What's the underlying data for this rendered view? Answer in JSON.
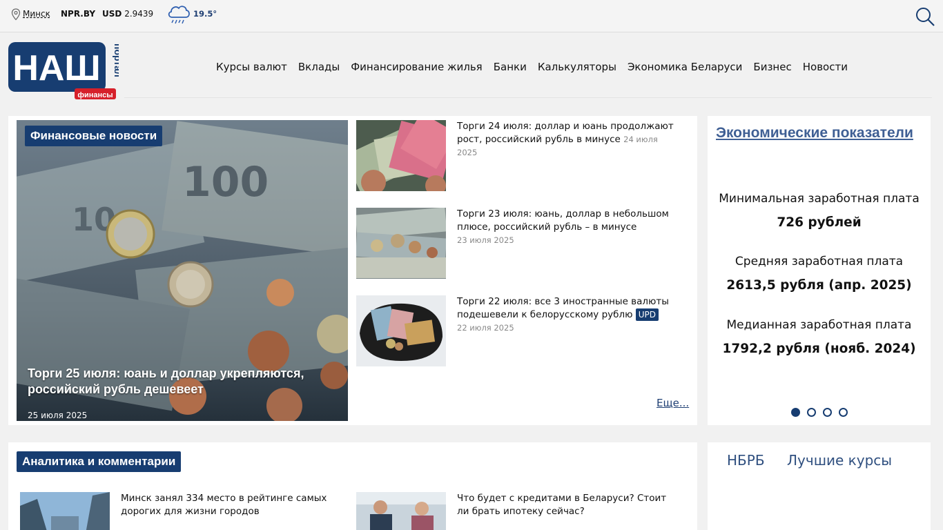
{
  "topbar": {
    "city": "Минск",
    "site": "NPR.BY",
    "usd_label": "USD",
    "usd_value": "2.9439",
    "temperature": "19.5°"
  },
  "logo": {
    "main": "НАШ",
    "side": "портал",
    "badge": "финансы"
  },
  "nav": [
    "Курсы валют",
    "Вклады",
    "Финансирование жилья",
    "Банки",
    "Калькуляторы",
    "Экономика Беларуси",
    "Бизнес",
    "Новости"
  ],
  "featured": {
    "tag": "Финансовые новости",
    "title": "Торги 25 июля: юань и доллар укрепляются, российский рубль дешевеет",
    "date": "25 июля 2025"
  },
  "news": [
    {
      "title": "Торги 24 июля: доллар и юань продолжают рост, российский рубль в минусе",
      "date": "24 июля 2025"
    },
    {
      "title": "Торги 23 июля: юань, доллар в небольшом плюсе, российский рубль – в минусе",
      "date": "23 июля 2025"
    },
    {
      "title": "Торги 22 июля: все 3 иностранные валюты подешевели к белорусскому рублю",
      "badge": "UPD",
      "date": "22 июля 2025"
    }
  ],
  "more_link": "Еще...",
  "econ": {
    "title": "Экономические показатели",
    "stats": [
      {
        "label": "Минимальная заработная плата",
        "value": "726 рублей"
      },
      {
        "label": "Средняя заработная плата",
        "value": "2613,5 рубля (апр. 2025)"
      },
      {
        "label": "Медианная заработная плата",
        "value": "1792,2 рубля (нояб. 2024)"
      }
    ],
    "slides": 4,
    "active_slide": 1
  },
  "analytics": {
    "tag": "Аналитика и комментарии",
    "items": [
      {
        "title": "Минск занял 334 место в рейтинге самых дорогих для жизни городов"
      },
      {
        "title": "Что будет с кредитами в Беларуси? Стоит ли брать ипотеку сейчас?"
      }
    ]
  },
  "rates_tabs": [
    "НБРБ",
    "Лучшие курсы"
  ],
  "colors": {
    "brand": "#173d71",
    "link": "#3f5f94",
    "background": "#f1f1f1",
    "badge_red": "#d6202a"
  }
}
